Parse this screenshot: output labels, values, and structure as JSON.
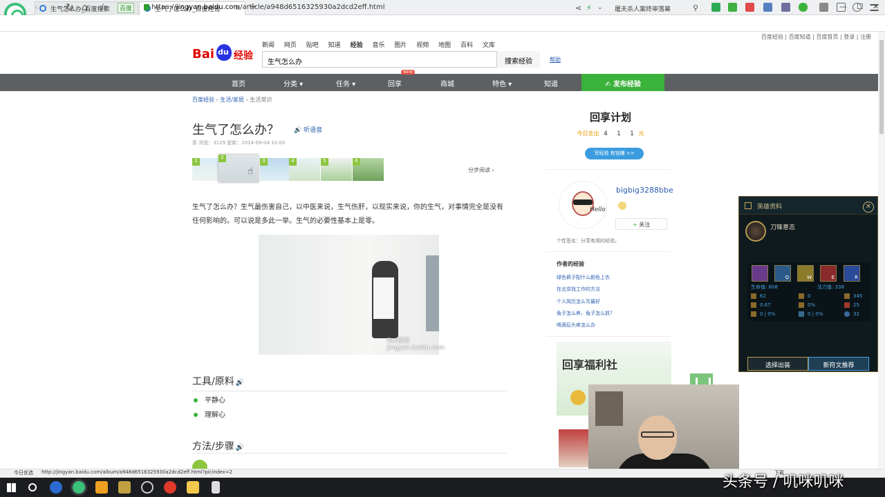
{
  "browser": {
    "tabs": [
      {
        "title": "生气怎么办_百度搜索"
      },
      {
        "title": "生气了怎么办_百度经验"
      }
    ],
    "site_badge": "百度",
    "url_prefix": "https://",
    "url_host": "jingyan.baidu.com",
    "url_path": "/article/a948d6516325930a2dcd2eff.html",
    "search_value": "屠夫杀人案终审落幕",
    "status_left": "今日优选",
    "status_url": "http://jingyan.baidu.com/album/a948d6516325930a2dcd2eff.html?picindex=2",
    "status_right": "下载"
  },
  "header": {
    "top_links": "百度经验 | 百度知道 | 百度首页 | 登录 | 注册",
    "logo_text": "Bai",
    "logo_paw": "du",
    "logo_suffix": "经验",
    "top_nav": [
      "新闻",
      "网页",
      "贴吧",
      "知道",
      "经验",
      "音乐",
      "图片",
      "视频",
      "地图",
      "百科",
      "文库"
    ],
    "search_value": "生气怎么办",
    "search_button": "搜索经验",
    "help_link": "帮助"
  },
  "main_nav": {
    "items": [
      "首页",
      "分类 ▾",
      "任务 ▾",
      "回享",
      "商城",
      "特色 ▾",
      "知道"
    ],
    "new_badge": "NEW",
    "publish": "✍ 发布经验"
  },
  "article": {
    "breadcrumb": [
      "百度经验",
      "生活/家居",
      "生活常识"
    ],
    "title": "生气了怎么办？",
    "listen": "🔊 听语音",
    "meta": "原     浏览：3129     更新：2014-09-04 10:00",
    "thumb_numbers": [
      "1",
      "2",
      "3",
      "4",
      "5",
      "6"
    ],
    "step_link": "分步阅读 ›",
    "intro": "生气了怎么办？生气最伤害自己，以中医来说，生气伤肝，以现实来说，你的生气，对事情完全是没有任何影响的。可以说是多此一举。生气的必要性基本上是零。",
    "image_watermark": "Bai经验 jingyan.baidu.com",
    "tools_heading": "工具/原料",
    "tools": [
      "平静心",
      "理解心"
    ],
    "steps_heading": "方法/步骤",
    "speaker": "🔊"
  },
  "sidebar": {
    "plan_title": "回享计划",
    "plan_label": "今日支出",
    "plan_digits": [
      "4",
      "1",
      "1"
    ],
    "plan_unit": "元",
    "write_button": "写经验 有钱赚 >>",
    "username": "bigbig3288bbe",
    "follow": "关注",
    "signature": "个性签名：分享有用的经验。",
    "exp_heading": "作者的经验",
    "exp_links": [
      "绿色裤子配什么颜色上衣",
      "在北京找工作的方法",
      "个人简历怎么写最好",
      "兔子怎么养，兔子怎么抓？",
      "喝酒后头疼怎么办"
    ],
    "promo_title": "回享福利社",
    "avatar_hello": "Hello"
  },
  "lol_panel": {
    "title": "英雄资料",
    "champion": "刀锋意志",
    "skill_keys": [
      "",
      "Q",
      "W",
      "E",
      "R"
    ],
    "hp_label": "生命值: 608",
    "mp_label": "法力值: 338",
    "stats": [
      [
        "62",
        "0",
        "345"
      ],
      [
        "0.67",
        "0%",
        "25"
      ],
      [
        "0 | 0%",
        "0 | 0%",
        "32"
      ]
    ],
    "btn_left": "选择出装",
    "btn_right": "新符文推荐"
  },
  "watermark": "头条号 / 叽咪叽咪"
}
